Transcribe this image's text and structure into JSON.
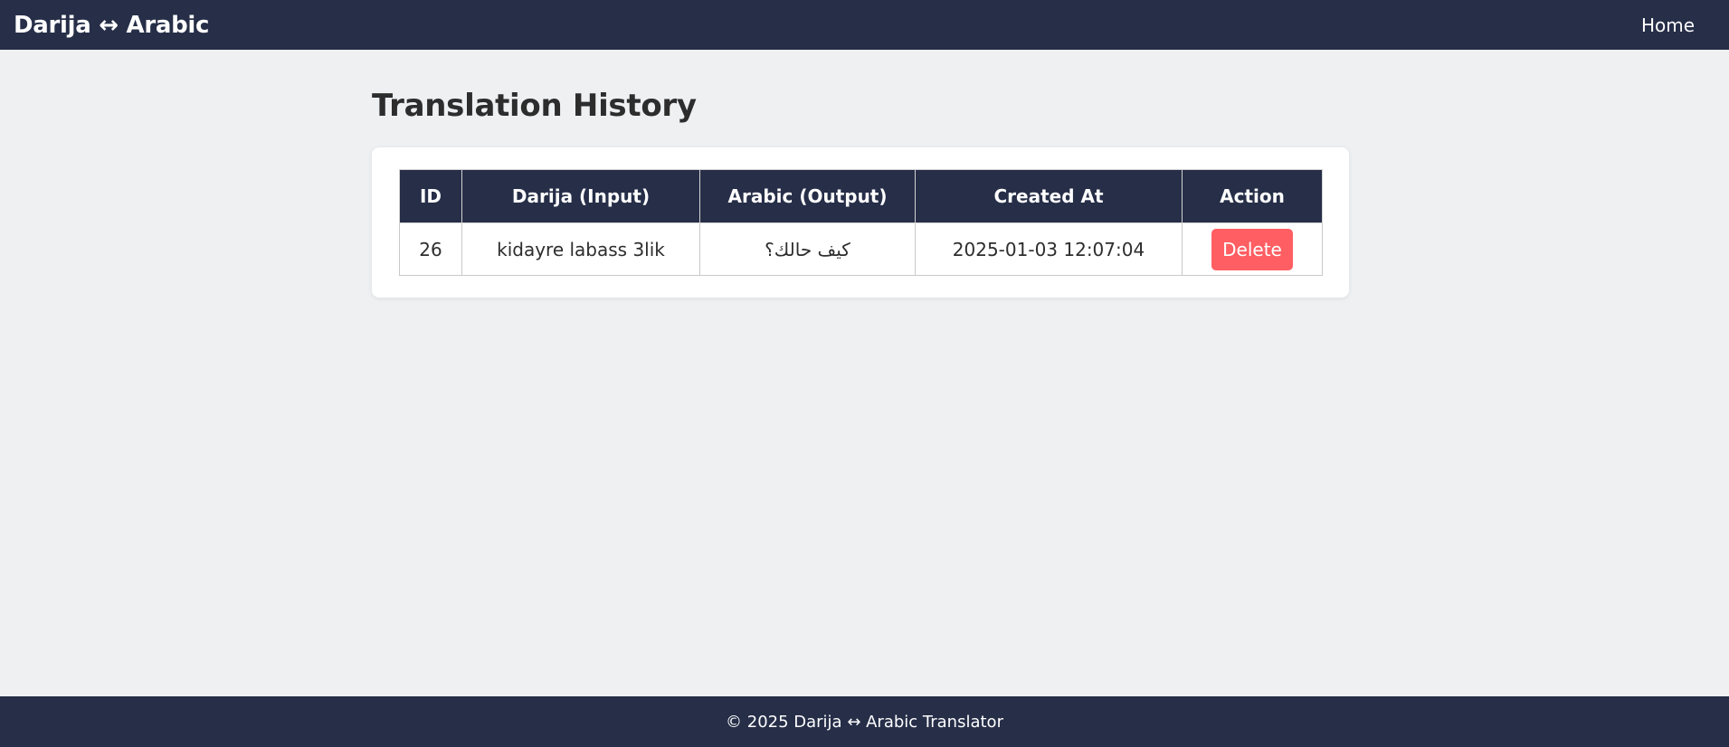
{
  "header": {
    "brand": "Darija ↔ Arabic",
    "nav_home": "Home"
  },
  "main": {
    "title": "Translation History"
  },
  "table": {
    "columns": [
      "ID",
      "Darija (Input)",
      "Arabic (Output)",
      "Created At",
      "Action"
    ],
    "rows": [
      {
        "id": "26",
        "darija": "kidayre labass 3lik",
        "arabic": "كيف حالك؟",
        "created_at": "2025-01-03 12:07:04",
        "action": "Delete"
      }
    ]
  },
  "footer": {
    "text": "© 2025 Darija ↔ Arabic Translator"
  },
  "colors": {
    "navbar_bg": "#262e48",
    "page_bg": "#eef0f2",
    "delete_button": "#ff5e62"
  }
}
